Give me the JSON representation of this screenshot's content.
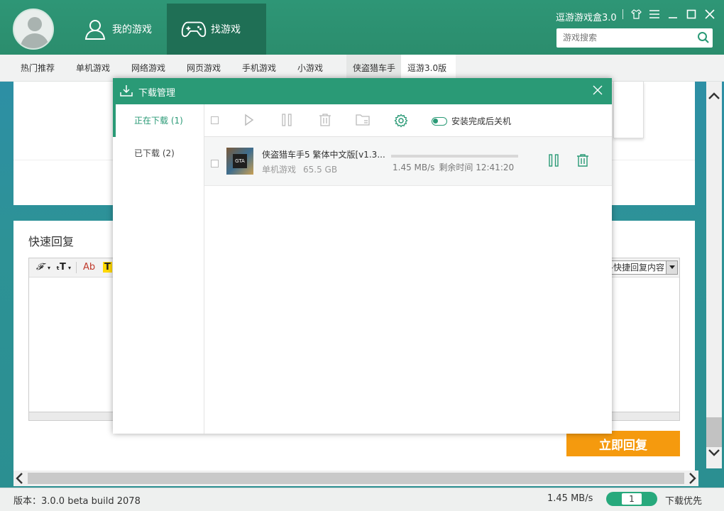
{
  "app": {
    "title": "逗游游戏盒3.0",
    "search_placeholder": "游戏搜索",
    "accent_color": "#2a9a76"
  },
  "nav": {
    "my_games": "我的游戏",
    "find_games": "找游戏"
  },
  "categories": [
    "热门推荐",
    "单机游戏",
    "网络游戏",
    "网页游戏",
    "手机游戏",
    "小游戏",
    "侠盗猎车手",
    "逗游3.0版"
  ],
  "quick_reply": {
    "title": "快速回复",
    "toolbar": {
      "font": "𝓕",
      "size": "ₜT",
      "color": "Ab",
      "highlight": "T"
    },
    "select_value": "快捷回复内容--",
    "submit_label": "立即回复"
  },
  "status_bar": {
    "version": "版本：3.0.0 beta build 2078",
    "speed": "1.45 MB/s",
    "task_count": "1",
    "priority": "下载优先"
  },
  "download_manager": {
    "title": "下载管理",
    "tabs": [
      {
        "label": "正在下载 (1)"
      },
      {
        "label": "已下载 (2)"
      }
    ],
    "shutdown_label": "安装完成后关机",
    "items": [
      {
        "name": "侠盗猎车手5  繁体中文版[v1.3...",
        "category": "单机游戏",
        "size": "65.5 GB",
        "speed": "1.45 MB/s",
        "remaining": "剩余时间 12:41:20",
        "progress": 0.0
      }
    ]
  }
}
